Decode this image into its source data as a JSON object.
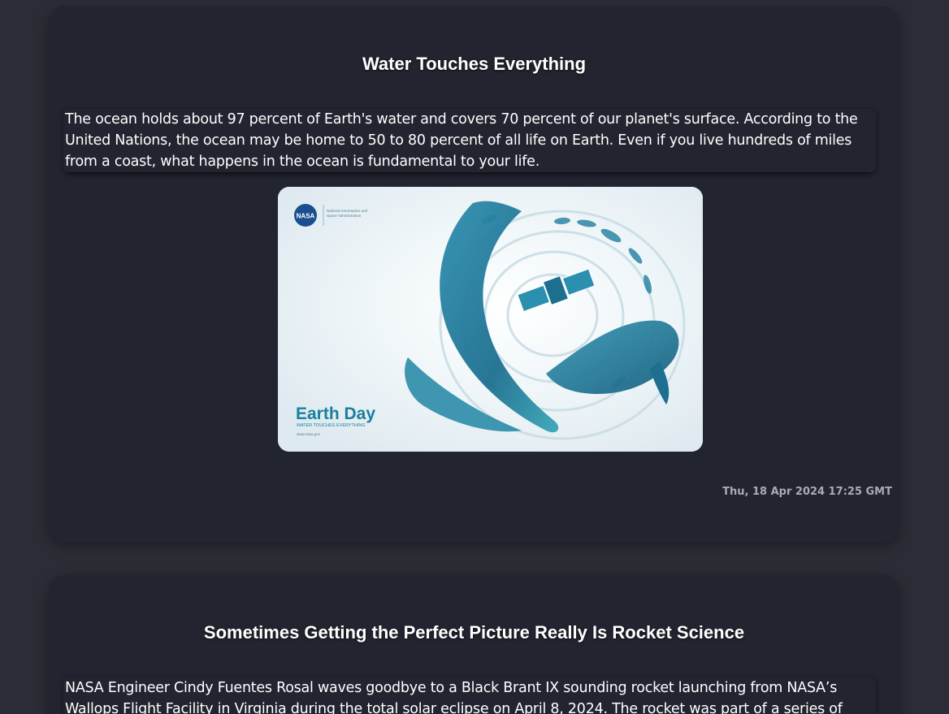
{
  "posts": [
    {
      "title": "Water Touches Everything",
      "description": "The ocean holds about 97 percent of Earth's water and covers 70 percent of our planet's surface. According to the United Nations, the ocean may be home to 50 to 80 percent of all life on Earth. Even if you live hundreds of miles from a coast, what happens in the ocean is fundamental to your life.",
      "image": {
        "brand": "NASA",
        "tagline_line1": "National Aeronautics and",
        "tagline_line2": "Space Administration",
        "headline": "Earth Day",
        "subheadline": "WATER TOUCHES EVERYTHING",
        "url": "www.nasa.gov"
      },
      "date": "Thu, 18 Apr 2024 17:25 GMT"
    },
    {
      "title": "Sometimes Getting the Perfect Picture Really Is Rocket Science",
      "description": "NASA Engineer Cindy Fuentes Rosal waves goodbye to a Black Brant IX sounding rocket launching from NASA’s Wallops Flight Facility in Virginia during the total solar eclipse on April 8, 2024. The rocket was part of a series of three"
    }
  ],
  "colors": {
    "page_background": "#2a2d35",
    "card_background": "#22242f",
    "date_text": "#a9acb3",
    "poster_teal": "#1a7f9c",
    "poster_background": "#e9f2f6"
  }
}
